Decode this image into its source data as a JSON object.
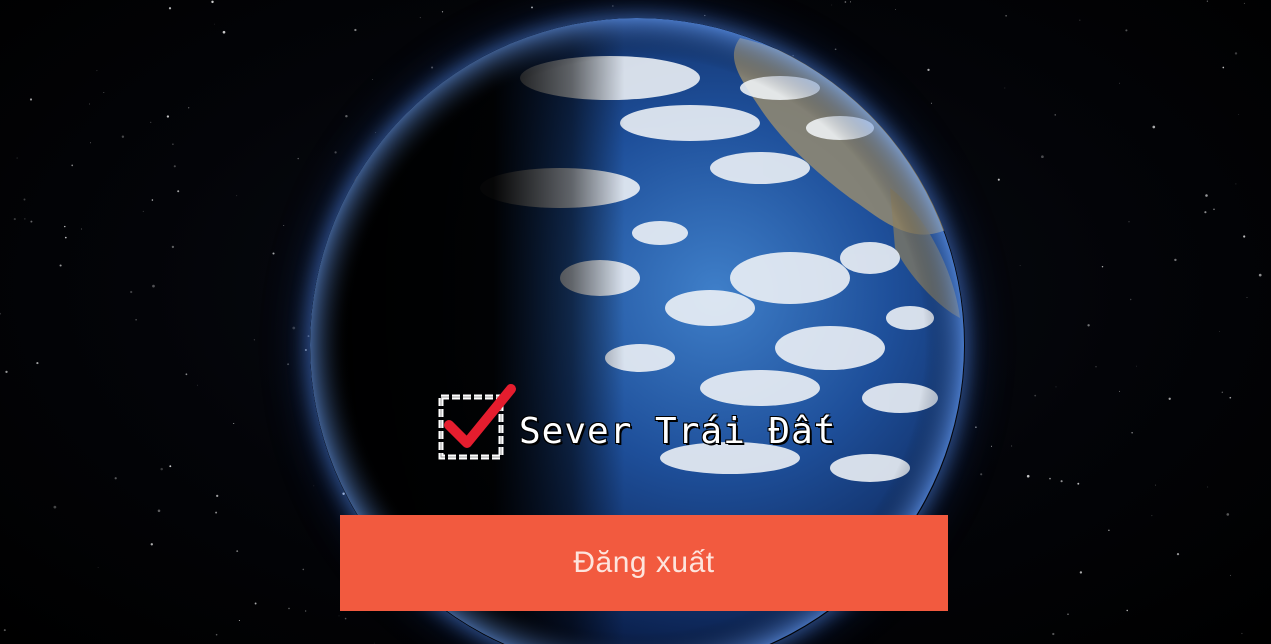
{
  "server": {
    "checked": true,
    "label": "Sever Trái Đất",
    "checkbox_icon": "checkbox-checked-icon",
    "check_color": "#e51d2e"
  },
  "logout": {
    "label": "Đăng xuất",
    "background_color": "#f25a3f"
  },
  "background": {
    "image": "earth-in-space"
  }
}
